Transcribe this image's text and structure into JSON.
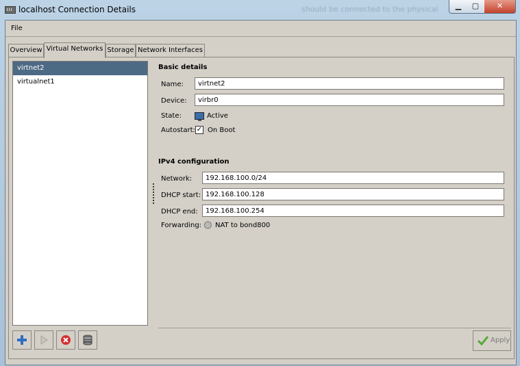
{
  "window": {
    "title": "localhost Connection Details",
    "background_title": "should be connected to the physical",
    "controls": {
      "minimize": "▁",
      "maximize": "▢",
      "close": "✕"
    }
  },
  "menubar": {
    "file": "File"
  },
  "tabs": [
    {
      "label": "Overview",
      "active": false
    },
    {
      "label": "Virtual Networks",
      "active": true
    },
    {
      "label": "Storage",
      "active": false
    },
    {
      "label": "Network Interfaces",
      "active": false
    }
  ],
  "networks": [
    {
      "name": "virtnet2",
      "selected": true
    },
    {
      "name": "virtualnet1",
      "selected": false
    }
  ],
  "basic": {
    "heading": "Basic details",
    "name_label": "Name:",
    "name_value": "virtnet2",
    "device_label": "Device:",
    "device_value": "virbr0",
    "state_label": "State:",
    "state_value": "Active",
    "autostart_label": "Autostart:",
    "autostart_value": "On Boot",
    "autostart_checked": true
  },
  "ipv4": {
    "heading": "IPv4 configuration",
    "network_label": "Network:",
    "network_value": "192.168.100.0/24",
    "dhcp_start_label": "DHCP start:",
    "dhcp_start_value": "192.168.100.128",
    "dhcp_end_label": "DHCP end:",
    "dhcp_end_value": "192.168.100.254",
    "forwarding_label": "Forwarding:",
    "forwarding_value": "NAT to bond800"
  },
  "toolbar": {
    "add_icon": "plus-icon",
    "start_icon": "play-icon",
    "stop_icon": "stop-icon",
    "delete_icon": "database-icon",
    "apply_label": "Apply"
  },
  "colors": {
    "selection": "#4d6a85",
    "add": "#2f6fc2",
    "stop": "#d32f2f",
    "apply_check": "#5aa83c"
  }
}
